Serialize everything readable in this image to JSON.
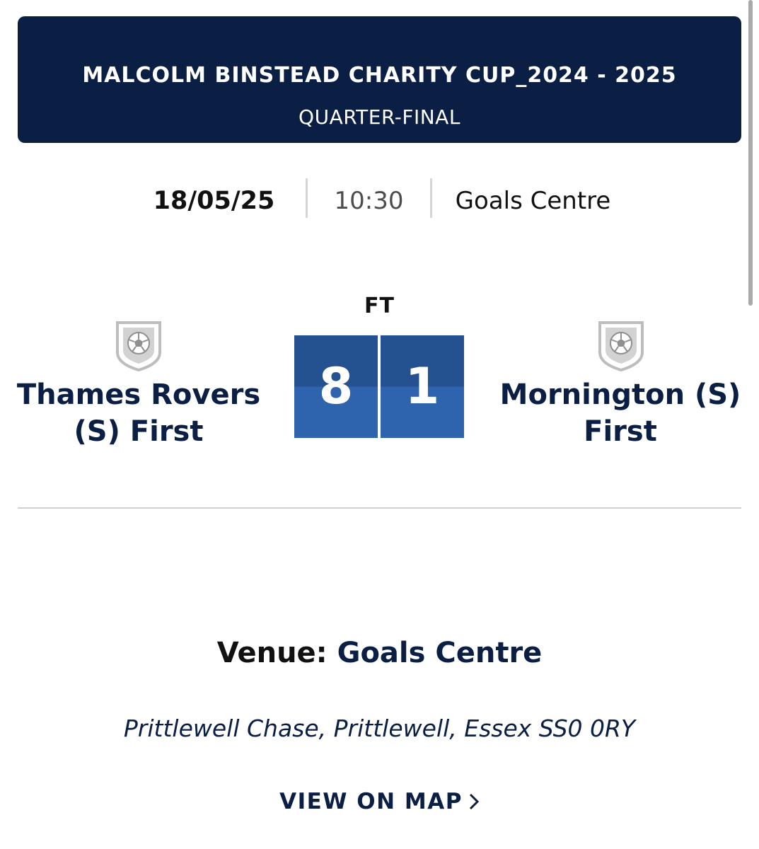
{
  "competition": {
    "title": "MALCOLM BINSTEAD CHARITY CUP_2024 - 2025",
    "round": "QUARTER-FINAL"
  },
  "fixture": {
    "date": "18/05/25",
    "time": "10:30",
    "venue": "Goals Centre",
    "status": "FT"
  },
  "home_team": {
    "name": "Thames Rovers (S) First",
    "score": "8",
    "crest_icon": "football-shield-icon"
  },
  "away_team": {
    "name": "Mornington (S) First",
    "score": "1",
    "crest_icon": "football-shield-icon"
  },
  "venue_section": {
    "label": "Venue:",
    "name": "Goals Centre",
    "address": "Prittlewell Chase, Prittlewell, Essex SS0 0RY",
    "map_link": "VIEW ON MAP"
  },
  "colors": {
    "navy": "#0b1f44",
    "score_top": "#24518f",
    "score_bottom": "#2e64ad",
    "divider": "#d0d0d0"
  }
}
